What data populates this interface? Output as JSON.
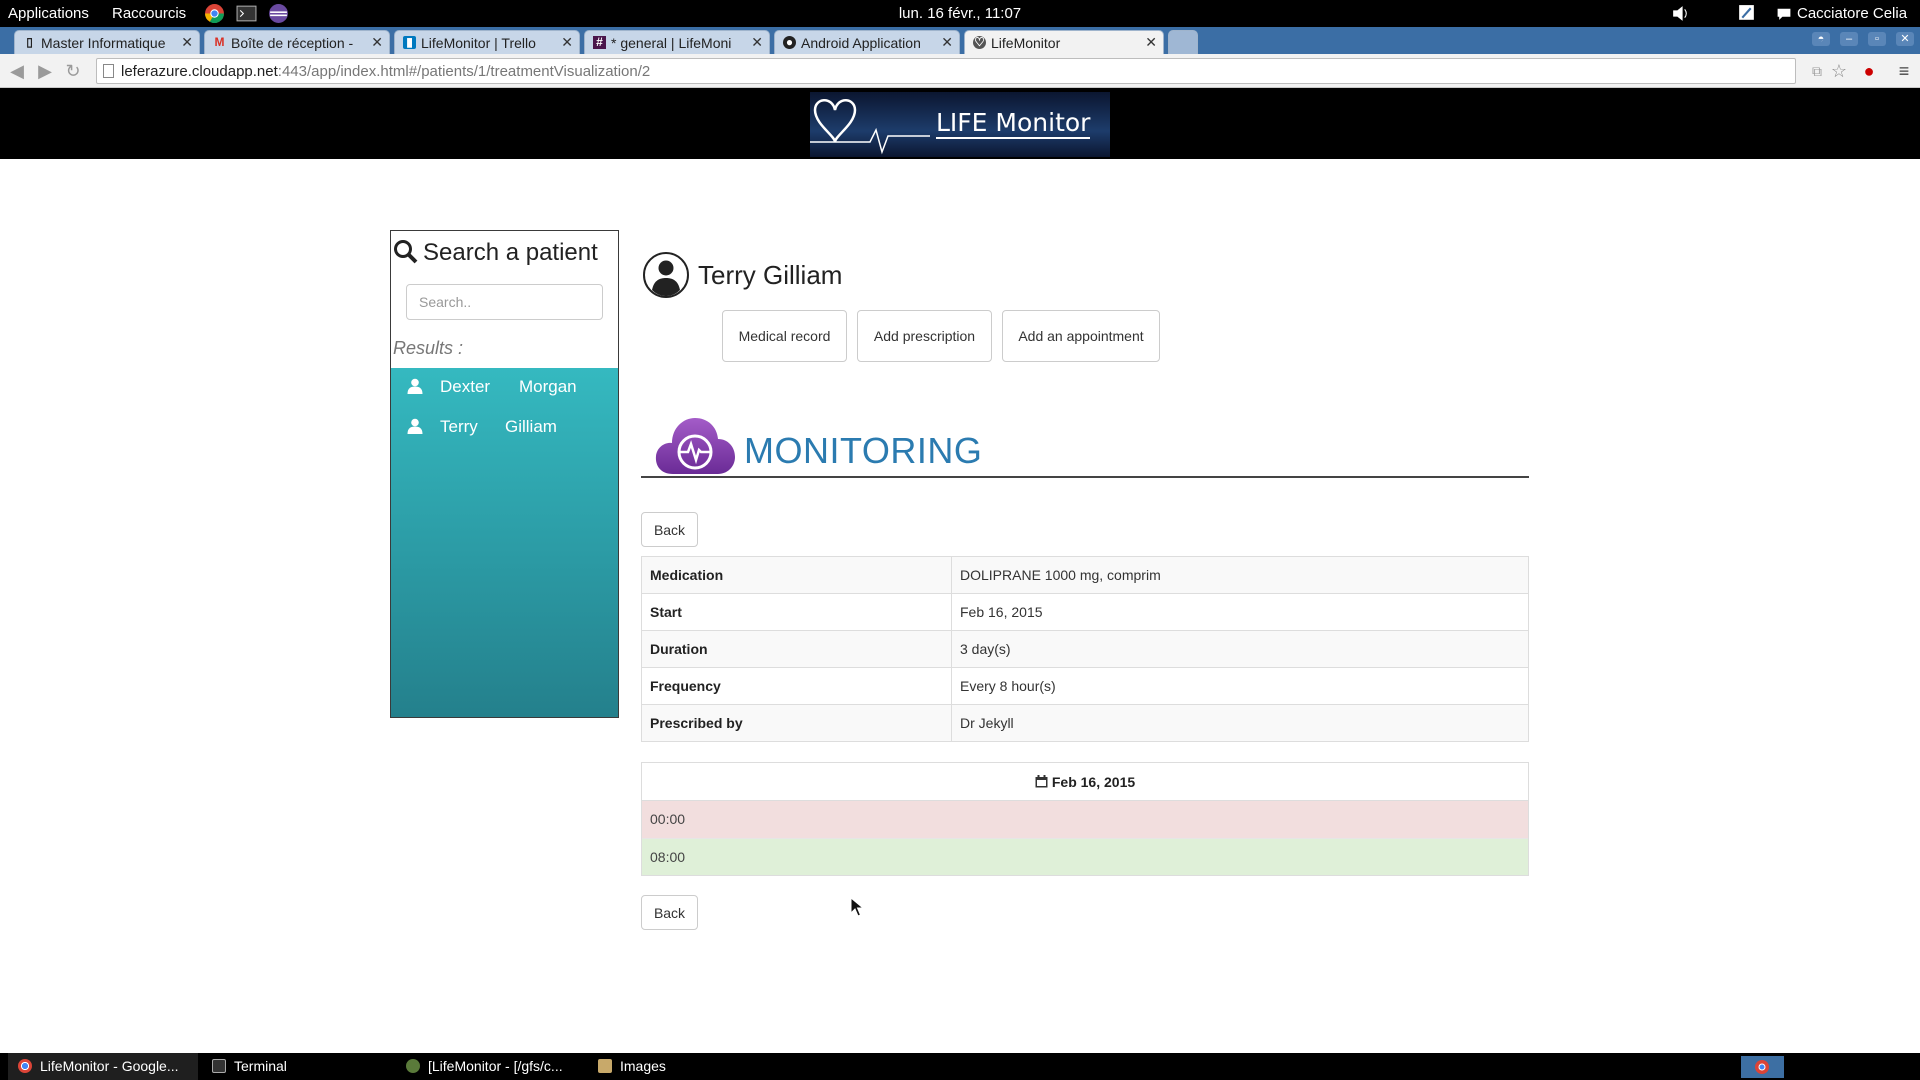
{
  "system_bar": {
    "applications": "Applications",
    "shortcuts": "Raccourcis",
    "clock": "lun. 16 févr., 11:07",
    "user": "Cacciatore Celia"
  },
  "browser": {
    "tabs": [
      {
        "label": "Master Informatique",
        "icon": "page-icon"
      },
      {
        "label": "Boîte de réception -",
        "icon": "gmail-icon"
      },
      {
        "label": "LifeMonitor | Trello",
        "icon": "trello-icon"
      },
      {
        "label": "* general | LifeMoni",
        "icon": "slack-icon"
      },
      {
        "label": "Android Application",
        "icon": "github-icon"
      },
      {
        "label": "LifeMonitor",
        "icon": "lifemonitor-icon",
        "active": true
      }
    ],
    "url_host": "leferazure.cloudapp.net",
    "url_rest": ":443/app/index.html#/patients/1/treatmentVisualization/2"
  },
  "header": {
    "logo_text": "LIFE Monitor"
  },
  "sidebar": {
    "title": "Search a patient",
    "search_placeholder": "Search..",
    "results_label": "Results :",
    "results": [
      {
        "first": "Dexter",
        "last": "Morgan"
      },
      {
        "first": "Terry",
        "last": "Gilliam"
      }
    ]
  },
  "patient": {
    "name": "Terry Gilliam",
    "actions": {
      "medical_record": "Medical record",
      "add_prescription": "Add prescription",
      "add_appointment": "Add an appointment"
    }
  },
  "monitoring": {
    "title": "MONITORING",
    "back_label": "Back",
    "details": [
      {
        "key": "Medication",
        "value": "DOLIPRANE 1000 mg, comprim"
      },
      {
        "key": "Start",
        "value": "Feb 16, 2015"
      },
      {
        "key": "Duration",
        "value": "3 day(s)"
      },
      {
        "key": "Frequency",
        "value": "Every 8 hour(s)"
      },
      {
        "key": "Prescribed by",
        "value": "Dr Jekyll"
      }
    ],
    "schedule": {
      "date": "Feb 16, 2015",
      "slots": [
        {
          "time": "00:00",
          "status": "missed",
          "color": "#f2dede"
        },
        {
          "time": "08:00",
          "status": "taken",
          "color": "#dff0d8"
        }
      ]
    }
  },
  "taskbar": {
    "items": [
      {
        "label": "LifeMonitor - Google...",
        "icon": "chrome-icon"
      },
      {
        "label": "Terminal",
        "icon": "terminal-icon"
      },
      {
        "label": "[LifeMonitor - [/gfs/c...",
        "icon": "eclipse-icon"
      },
      {
        "label": "Images",
        "icon": "folder-icon"
      }
    ]
  },
  "colors": {
    "results_teal": "#35b9c0",
    "monitoring_blue": "#2b7bb0",
    "monitoring_purple": "#7b3fa8",
    "tabstrip_blue": "#3b6ea5"
  }
}
